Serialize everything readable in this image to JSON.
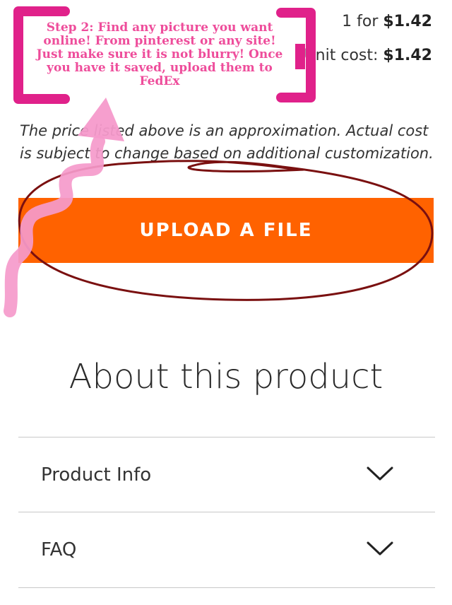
{
  "pricing": {
    "qty_prefix": "1 for ",
    "qty_price": "$1.42",
    "unit_prefix": "Unit cost: ",
    "unit_price": "$1.42"
  },
  "disclaimer": "The price listed above is an approximation. Actual cost is subject to change based on additional customization.",
  "upload_button": "UPLOAD A FILE",
  "about": {
    "heading": "About this product",
    "rows": [
      {
        "label": "Product Info"
      },
      {
        "label": "FAQ"
      }
    ]
  },
  "annotation": {
    "note": "Step 2: Find any picture you want online! From pinterest or any site! Just make sure it is not blurry! Once you have it saved, upload them to FedEx",
    "bracket_color": "#e0218a",
    "arrow_color": "#f59acb",
    "circle_color": "#7a1010"
  },
  "colors": {
    "accent": "#ff6200"
  }
}
